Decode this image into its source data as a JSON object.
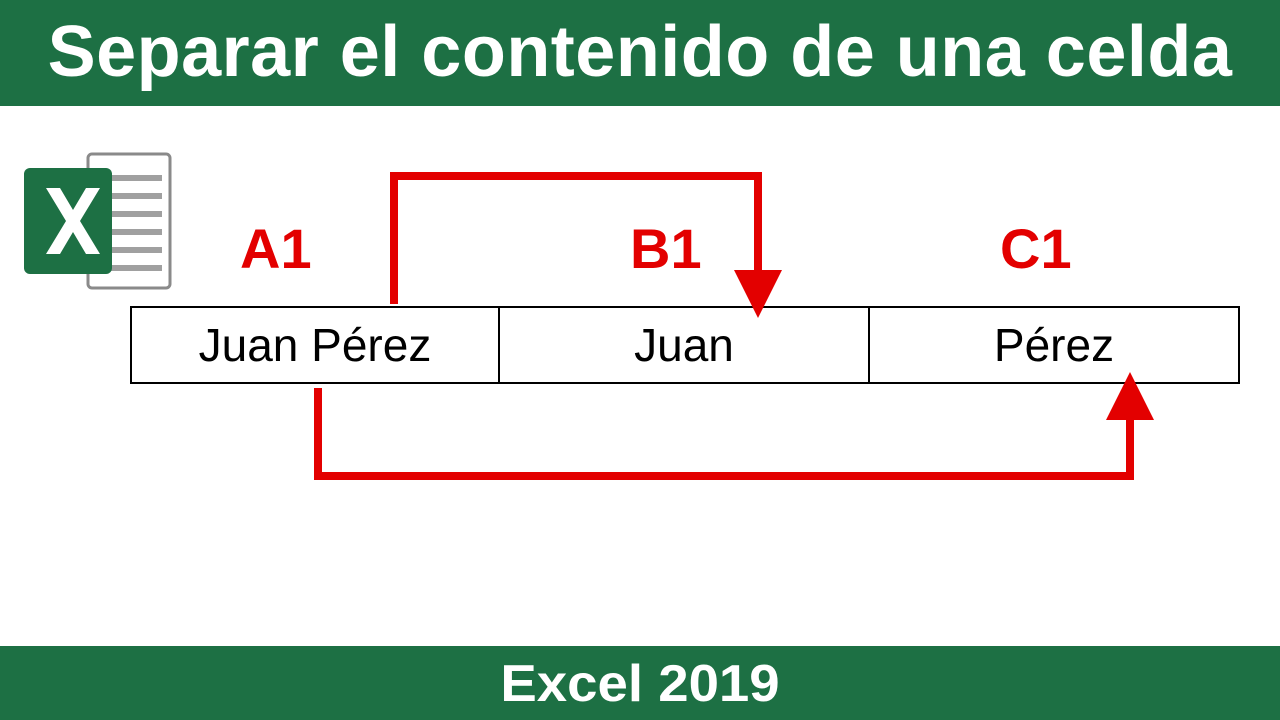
{
  "title": "Separar el contenido de una celda",
  "footer": "Excel 2019",
  "labels": {
    "a": "A1",
    "b": "B1",
    "c": "C1"
  },
  "cells": {
    "a": "Juan Pérez",
    "b": "Juan",
    "c": "Pérez"
  },
  "colors": {
    "brand_green": "#1d7044",
    "arrow_red": "#e30000"
  }
}
